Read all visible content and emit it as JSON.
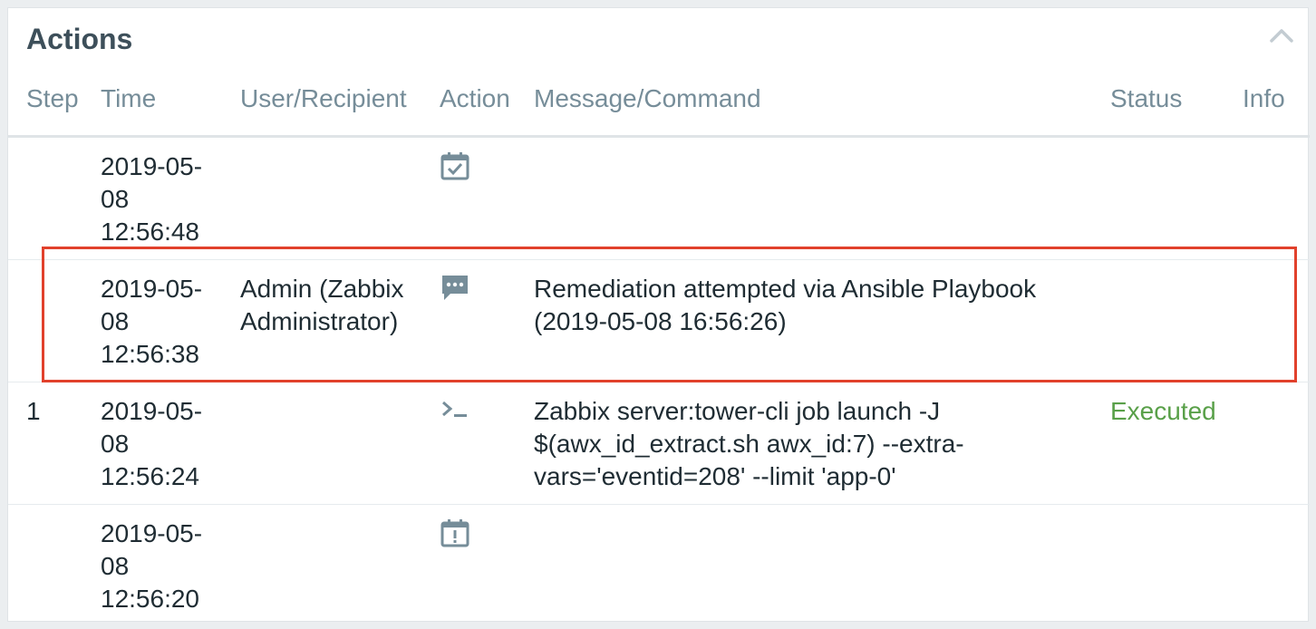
{
  "panel": {
    "title": "Actions",
    "collapse_icon": "chevron-up-icon"
  },
  "table": {
    "columns": [
      "Step",
      "Time",
      "User/Recipient",
      "Action",
      "Message/Command",
      "Status",
      "Info"
    ],
    "rows": [
      {
        "step": "",
        "time": [
          "2019-05-",
          "08",
          "12:56:48"
        ],
        "user": "",
        "action_icon": "calendar-check-icon",
        "message": "",
        "status": "",
        "info": ""
      },
      {
        "step": "",
        "time": [
          "2019-05-",
          "08",
          "12:56:38"
        ],
        "user": "Admin (Zabbix Administrator)",
        "action_icon": "message-icon",
        "message": "Remediation attempted via Ansible Playbook (2019-05-08 16:56:26)",
        "status": "",
        "info": ""
      },
      {
        "step": "1",
        "time": [
          "2019-05-",
          "08",
          "12:56:24"
        ],
        "user": "",
        "action_icon": "terminal-icon",
        "message": "Zabbix server:tower-cli job launch -J $(awx_id_extract.sh awx_id:7) --extra-vars='eventid=208' --limit 'app-0'",
        "status": "Executed",
        "info": ""
      },
      {
        "step": "",
        "time": [
          "2019-05-",
          "08",
          "12:56:20"
        ],
        "user": "",
        "action_icon": "calendar-alert-icon",
        "message": "",
        "status": "",
        "info": ""
      }
    ]
  },
  "colors": {
    "highlight": "#e1412c",
    "status_executed": "#59a049",
    "header_text": "#768d99",
    "icon": "#768d99"
  }
}
